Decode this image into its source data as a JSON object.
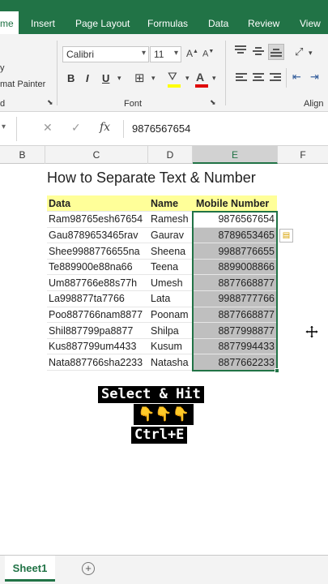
{
  "ribbon": {
    "tabs": [
      "me",
      "Insert",
      "Page Layout",
      "Formulas",
      "Data",
      "Review",
      "View"
    ],
    "clipboard": {
      "copy_label": "y",
      "format_painter_label": "mat Painter",
      "group_label": "d"
    },
    "font": {
      "family": "Calibri",
      "size": "11",
      "group_label": "Font",
      "bold": "B",
      "italic": "I",
      "underline": "U"
    },
    "alignment": {
      "group_label": "Align"
    }
  },
  "formula_bar": {
    "fx_symbol": "fx",
    "value": "9876567654"
  },
  "columns": [
    "B",
    "C",
    "D",
    "E",
    "F"
  ],
  "sheet": {
    "title": "How to Separate Text & Number",
    "headers": {
      "data": "Data",
      "name": "Name",
      "mobile": "Mobile Number"
    },
    "rows": [
      {
        "data": "Ram98765esh67654",
        "name": "Ramesh",
        "mobile": "9876567654"
      },
      {
        "data": "Gau8789653465rav",
        "name": "Gaurav",
        "mobile": "8789653465"
      },
      {
        "data": "Shee9988776655na",
        "name": "Sheena",
        "mobile": "9988776655"
      },
      {
        "data": "Te889900e88na66",
        "name": "Teena",
        "mobile": "8899008866"
      },
      {
        "data": "Um887766e88s77h",
        "name": "Umesh",
        "mobile": "8877668877"
      },
      {
        "data": "La998877ta7766",
        "name": "Lata",
        "mobile": "9988777766"
      },
      {
        "data": "Poo887766nam8877",
        "name": "Poonam",
        "mobile": "8877668877"
      },
      {
        "data": "Shil887799pa8877",
        "name": "Shilpa",
        "mobile": "8877998877"
      },
      {
        "data": "Kus887799um4433",
        "name": "Kusum",
        "mobile": "8877994433"
      },
      {
        "data": "Nata887766sha2233",
        "name": "Natasha",
        "mobile": "8877662233"
      }
    ]
  },
  "overlay": {
    "line1": "Select & Hit",
    "hands": "👇👇👇",
    "line2": "Ctrl+E"
  },
  "sheet_tabs": {
    "active": "Sheet1",
    "add_symbol": "+"
  },
  "colors": {
    "accent": "#217346",
    "header_fill": "#ffff99",
    "selection_fill": "#bfbfbf"
  }
}
